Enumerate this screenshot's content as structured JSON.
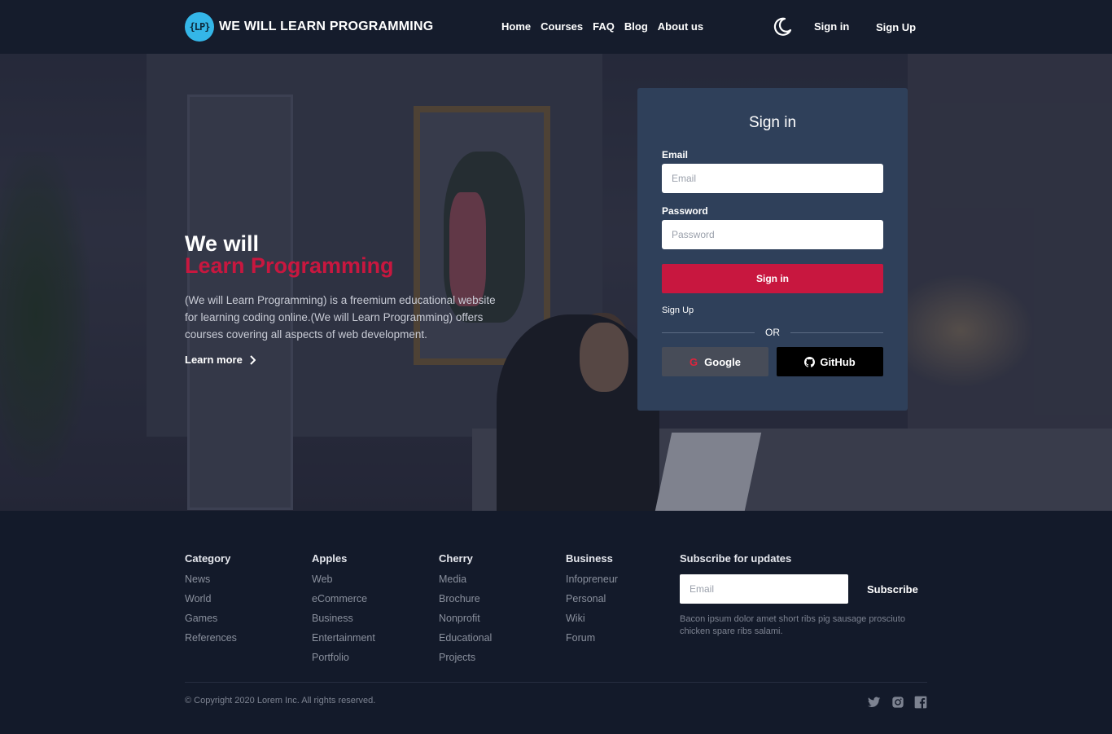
{
  "header": {
    "logo_badge": "{LP}",
    "brand": "WE WILL LEARN PROGRAMMING",
    "nav": [
      "Home",
      "Courses",
      "FAQ",
      "Blog",
      "About us"
    ],
    "theme_icon": "moon-icon",
    "sign_in": "Sign in",
    "sign_up": "Sign Up"
  },
  "hero": {
    "title_line1": "We will",
    "title_line2": "Learn Programming",
    "description": "(We will Learn Programming) is a freemium educational website for learning coding online.(We will Learn Programming) offers courses covering all aspects of web development.",
    "learn_more": "Learn more",
    "accent_color": "#c8173f"
  },
  "signin_card": {
    "title": "Sign in",
    "email_label": "Email",
    "email_placeholder": "Email",
    "password_label": "Password",
    "password_placeholder": "Password",
    "submit": "Sign in",
    "signup_link": "Sign Up",
    "or": "OR",
    "google": "Google",
    "github": "GitHub"
  },
  "footer": {
    "columns": [
      {
        "title": "Category",
        "links": [
          "News",
          "World",
          "Games",
          "References"
        ]
      },
      {
        "title": "Apples",
        "links": [
          "Web",
          "eCommerce",
          "Business",
          "Entertainment",
          "Portfolio"
        ]
      },
      {
        "title": "Cherry",
        "links": [
          "Media",
          "Brochure",
          "Nonprofit",
          "Educational",
          "Projects"
        ]
      },
      {
        "title": "Business",
        "links": [
          "Infopreneur",
          "Personal",
          "Wiki",
          "Forum"
        ]
      }
    ],
    "subscribe_title": "Subscribe for updates",
    "subscribe_placeholder": "Email",
    "subscribe_button": "Subscribe",
    "subscribe_note": "Bacon ipsum dolor amet short ribs pig sausage prosciuto chicken spare ribs salami.",
    "copyright": "© Copyright 2020 Lorem Inc. All rights reserved.",
    "social": [
      "twitter-icon",
      "instagram-icon",
      "facebook-icon"
    ]
  }
}
